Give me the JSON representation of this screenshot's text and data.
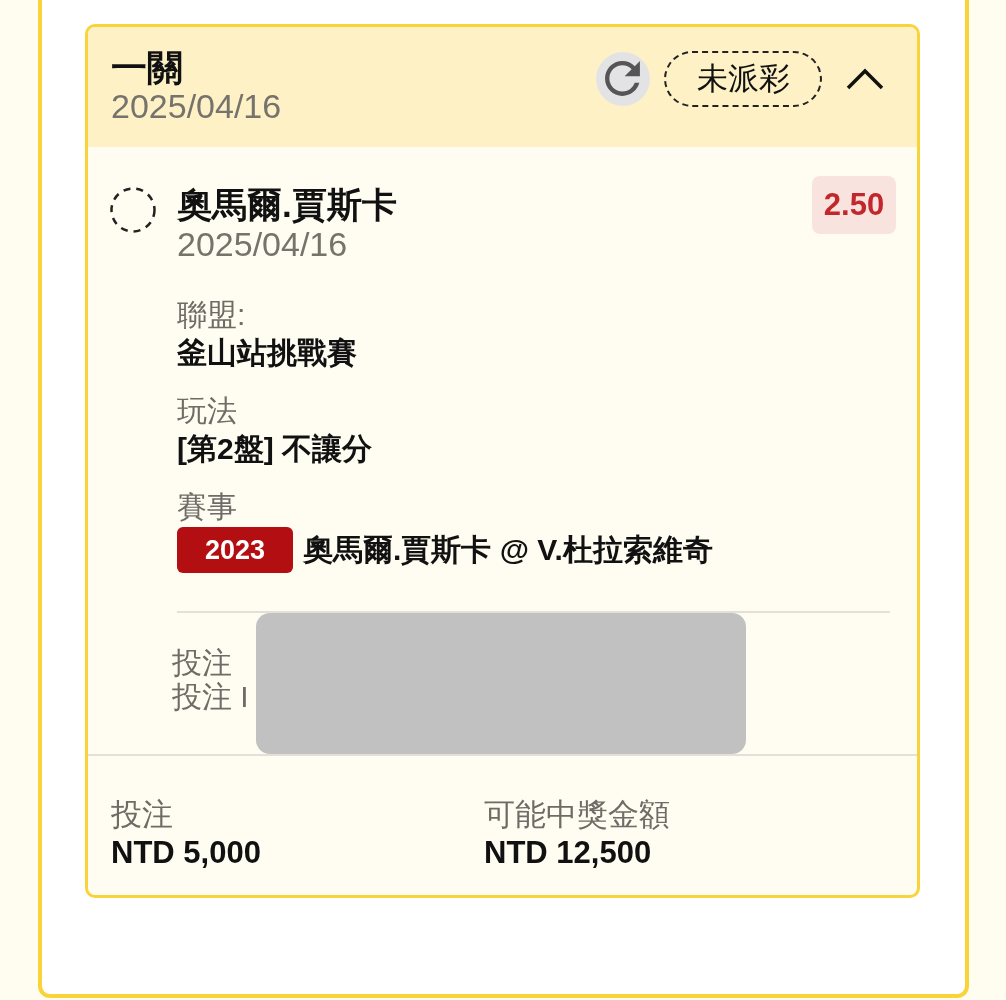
{
  "bet_card": {
    "title": "一關",
    "date": "2025/04/16",
    "status": "未派彩",
    "expanded": true,
    "selection": {
      "settled": false,
      "name": "奧馬爾.賈斯卡",
      "date": "2025/04/16",
      "odds": "2.50",
      "details": [
        {
          "label": "聯盟:",
          "value": "釜山站挑戰賽"
        },
        {
          "label": "玩法",
          "value": "[第2盤] 不讓分"
        },
        {
          "label": "賽事",
          "tag": "2023",
          "value": "奧馬爾.賈斯卡 @ V.杜拉索維奇"
        }
      ]
    },
    "bet_info": [
      "投注",
      "投注 I"
    ],
    "summary": [
      {
        "label": "投注",
        "value": "NTD 5,000"
      },
      {
        "label": "可能中獎金額",
        "value": "NTD 12,500"
      }
    ]
  }
}
